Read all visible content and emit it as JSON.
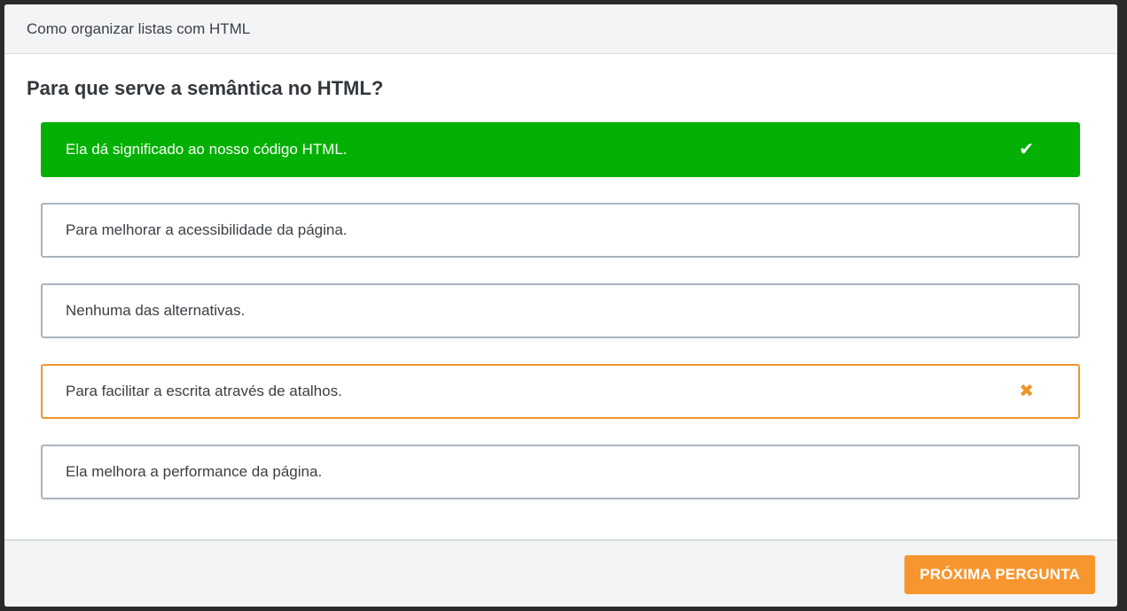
{
  "header": {
    "title": "Como organizar listas com HTML"
  },
  "question": {
    "text": "Para que serve a semântica no HTML?"
  },
  "options": [
    {
      "label": "Ela dá significado ao nosso código HTML.",
      "state": "correct",
      "icon": "check-icon",
      "mark": "✔"
    },
    {
      "label": "Para melhorar a acessibilidade da página.",
      "state": "default"
    },
    {
      "label": "Nenhuma das alternativas.",
      "state": "default"
    },
    {
      "label": "Para facilitar a escrita através de atalhos.",
      "state": "wrong",
      "icon": "close-icon",
      "mark": "✖"
    },
    {
      "label": "Ela melhora a performance da página.",
      "state": "default"
    }
  ],
  "footer": {
    "next_label": "PRÓXIMA PERGUNTA"
  },
  "colors": {
    "correct": "#03b003",
    "wrong": "#f0952b",
    "accent": "#f7962e",
    "border": "#aab4bd"
  }
}
